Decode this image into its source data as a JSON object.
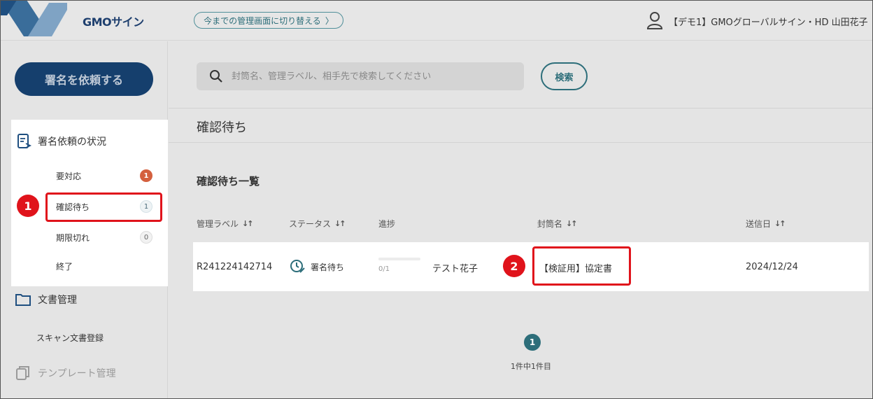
{
  "header": {
    "logo": "GMOサイン",
    "switch_label": "今までの管理画面に切り替える",
    "switch_chevron": "〉",
    "user_name": "【デモ1】GMOグローバルサイン・HD 山田花子"
  },
  "sidebar": {
    "request_button": "署名を依頼する",
    "status_heading": "署名依頼の状況",
    "items": [
      {
        "label": "要対応",
        "count": "1"
      },
      {
        "label": "確認待ち",
        "count": "1"
      },
      {
        "label": "期限切れ",
        "count": "0"
      },
      {
        "label": "終了"
      }
    ],
    "documents": "文書管理",
    "scan": "スキャン文書登録",
    "templates": "テンプレート管理"
  },
  "search": {
    "placeholder": "封筒名、管理ラベル、相手先で検索してください",
    "value": "",
    "button": "検索"
  },
  "main": {
    "page_title": "確認待ち",
    "list_title": "確認待ち一覧",
    "columns": {
      "label": "管理ラベル",
      "status": "ステータス",
      "progress": "進捗",
      "envelope": "封筒名",
      "sent": "送信日"
    },
    "sort_glyph": "↓↑",
    "rows": [
      {
        "label": "R241224142714",
        "status": "署名待ち",
        "progress_text": "0/1",
        "progress_fraction": 0,
        "recipient": "テスト花子",
        "envelope": "【検証用】協定書",
        "sent": "2024/12/24"
      }
    ],
    "pagination": {
      "current": "1",
      "info": "1件中1件目"
    }
  },
  "markers": [
    "1",
    "2"
  ],
  "colors": {
    "accent": "#2d6e7a",
    "brand": "#153f6d",
    "alert": "#e0131b",
    "badge": "#d4603e"
  }
}
